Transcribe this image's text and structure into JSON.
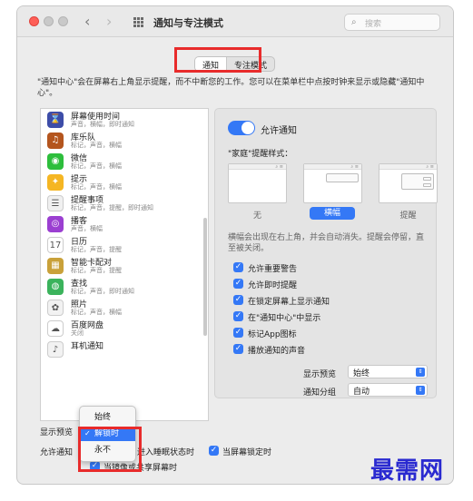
{
  "window": {
    "title": "通知与专注模式"
  },
  "search": {
    "placeholder": "搜索"
  },
  "tabs": [
    {
      "label": "通知"
    },
    {
      "label": "专注模式"
    }
  ],
  "description": "\"通知中心\"会在屏幕右上角显示提醒，而不中断您的工作。您可以在菜单栏中点按时钟来显示或隐藏\"通知中心\"。",
  "apps": [
    {
      "name": "屏幕使用时间",
      "sub": "声音，横幅，即时通知",
      "icon": "hourglass-icon",
      "color": "#3d4da8",
      "glyph": "⌛"
    },
    {
      "name": "库乐队",
      "sub": "标记，声音，横幅",
      "icon": "guitar-icon",
      "color": "#b4551e",
      "glyph": "♫"
    },
    {
      "name": "微信",
      "sub": "标记，声音，横幅",
      "icon": "wechat-icon",
      "color": "#2dbe3c",
      "glyph": "◉"
    },
    {
      "name": "提示",
      "sub": "标记，声音，横幅",
      "icon": "lightbulb-icon",
      "color": "#f5b623",
      "glyph": "✦"
    },
    {
      "name": "提醒事项",
      "sub": "标记，声音，提醒，即时通知",
      "icon": "list-icon",
      "color": "#f0f0f0",
      "glyph": "☰"
    },
    {
      "name": "播客",
      "sub": "声音，横幅",
      "icon": "podcast-icon",
      "color": "#9b3fd1",
      "glyph": "◎"
    },
    {
      "name": "日历",
      "sub": "标记，声音，提醒",
      "icon": "calendar-icon",
      "color": "#ffffff",
      "glyph": "17"
    },
    {
      "name": "智能卡配对",
      "sub": "标记，声音，提醒",
      "icon": "smartcard-icon",
      "color": "#c9a13a",
      "glyph": "▦"
    },
    {
      "name": "查找",
      "sub": "标记，声音，即时通知",
      "icon": "findmy-icon",
      "color": "#3bb35c",
      "glyph": "◍"
    },
    {
      "name": "照片",
      "sub": "标记，声音，横幅",
      "icon": "photos-icon",
      "color": "#f2f2f2",
      "glyph": "✿"
    },
    {
      "name": "百度网盘",
      "sub": "关闭",
      "icon": "cloud-icon",
      "color": "#ffffff",
      "glyph": "☁"
    },
    {
      "name": "耳机通知",
      "sub": "",
      "icon": "headphones-icon",
      "color": "#f2f2f2",
      "glyph": "♪"
    }
  ],
  "panel": {
    "allow_label": "允许通知",
    "style_label": "\"家庭\"提醒样式：",
    "styles": [
      {
        "label": "无"
      },
      {
        "label": "横幅"
      },
      {
        "label": "提醒"
      }
    ],
    "banner_desc": "横幅会出现在右上角，并会自动消失。提醒会停留，直至被关闭。",
    "checks": [
      {
        "label": "允许重要警告"
      },
      {
        "label": "允许即时提醒"
      },
      {
        "label": "在锁定屏幕上显示通知"
      },
      {
        "label": "在\"通知中心\"中显示"
      },
      {
        "label": "标记App图标"
      },
      {
        "label": "播放通知的声音"
      }
    ],
    "preview": {
      "label": "显示预览",
      "value": "始终"
    },
    "grouping": {
      "label": "通知分组",
      "value": "自动"
    }
  },
  "bottom": {
    "preview_label": "显示预览",
    "allow_label": "允许通知",
    "sleep_label": "进入睡眠状态时",
    "lock_label": "当屏幕锁定时",
    "mirror_label": "当镜像或共享屏幕时"
  },
  "popup": {
    "options": [
      {
        "label": "始终"
      },
      {
        "label": "解锁时"
      },
      {
        "label": "永不"
      }
    ]
  },
  "watermark": "最需网",
  "colors": {
    "accent": "#3478f6",
    "highlight": "#e82b2b"
  }
}
